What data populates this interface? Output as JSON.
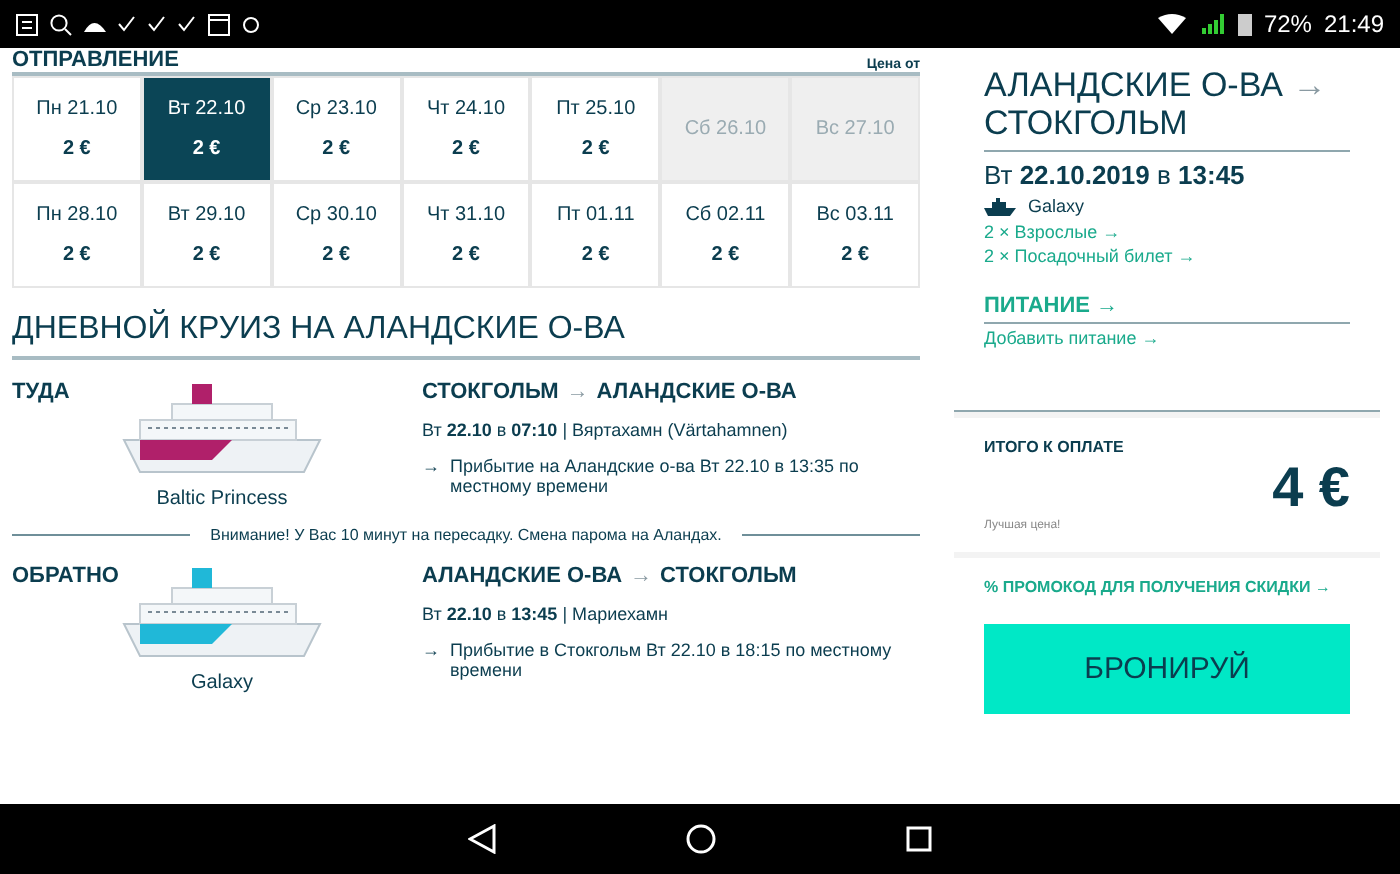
{
  "status_bar": {
    "battery": "72%",
    "time": "21:49"
  },
  "departure": {
    "title": "ОТПРАВЛЕНИЕ",
    "price_note": "Цена от",
    "days": [
      {
        "label": "Пн 21.10",
        "price": "2 €",
        "selected": false,
        "disabled": false
      },
      {
        "label": "Вт 22.10",
        "price": "2 €",
        "selected": true,
        "disabled": false
      },
      {
        "label": "Ср 23.10",
        "price": "2 €",
        "selected": false,
        "disabled": false
      },
      {
        "label": "Чт 24.10",
        "price": "2 €",
        "selected": false,
        "disabled": false
      },
      {
        "label": "Пт 25.10",
        "price": "2 €",
        "selected": false,
        "disabled": false
      },
      {
        "label": "Сб 26.10",
        "selected": false,
        "disabled": true
      },
      {
        "label": "Вс 27.10",
        "selected": false,
        "disabled": true
      },
      {
        "label": "Пн 28.10",
        "price": "2 €",
        "selected": false,
        "disabled": false
      },
      {
        "label": "Вт 29.10",
        "price": "2 €",
        "selected": false,
        "disabled": false
      },
      {
        "label": "Ср 30.10",
        "price": "2 €",
        "selected": false,
        "disabled": false
      },
      {
        "label": "Чт 31.10",
        "price": "2 €",
        "selected": false,
        "disabled": false
      },
      {
        "label": "Пт 01.11",
        "price": "2 €",
        "selected": false,
        "disabled": false
      },
      {
        "label": "Сб 02.11",
        "price": "2 €",
        "selected": false,
        "disabled": false
      },
      {
        "label": "Вс 03.11",
        "price": "2 €",
        "selected": false,
        "disabled": false
      }
    ]
  },
  "cruise": {
    "title": "ДНЕВНОЙ КРУИЗ НА АЛАНДСКИЕ О-ВА",
    "notice": "Внимание! У Вас 10 минут на пересадку. Смена парома на Аландах.",
    "legs": [
      {
        "direction": "ТУДА",
        "ship": "Baltic Princess",
        "color": "#b0206a",
        "route_from": "СТОКГОЛЬМ",
        "route_arrow": "→",
        "route_to": "АЛАНДСКИЕ О-ВА",
        "date_line": "Вт **22.10** в **07:10** | Вяртахамн (Värtahamnen)",
        "arrival_arrow": "→",
        "arrival": "Прибытие на Аландские о-ва Вт 22.10 в 13:35 по местному времени"
      },
      {
        "direction": "ОБРАТНО",
        "ship": "Galaxy",
        "color": "#20b8d8",
        "route_from": "АЛАНДСКИЕ О-ВА",
        "route_arrow": "→",
        "route_to": "СТОКГОЛЬМ",
        "date_line": "Вт **22.10** в **13:45** | Мариехамн",
        "arrival_arrow": "→",
        "arrival": "Прибытие в Стокгольм Вт 22.10 в 18:15 по местному времени"
      }
    ]
  },
  "summary": {
    "title_from": "АЛАНДСКИЕ О-ВА",
    "title_arrow": "→",
    "title_to": "СТОКГОЛЬМ",
    "date_line": "Вт **22.10.2019** в **13:45**",
    "ship": "Galaxy",
    "links": [
      "2 × Взрослые →",
      "2 × Посадочный билет →"
    ],
    "meals_title": "ПИТАНИЕ →",
    "meals_link": "Добавить питание →",
    "total_label": "ИТОГО К ОПЛАТЕ",
    "total": "4 €",
    "total_note": "Лучшая цена!",
    "promo": "% ПРОМОКОД ДЛЯ ПОЛУЧЕНИЯ СКИДКИ →",
    "book_button": "БРОНИРУЙ"
  }
}
